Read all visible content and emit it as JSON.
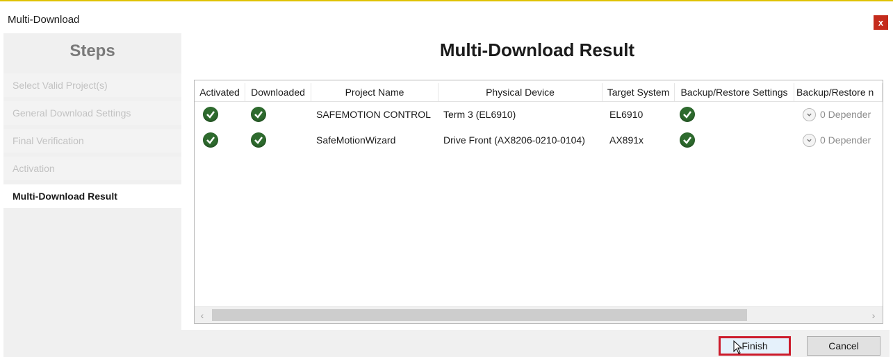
{
  "window": {
    "title": "Multi-Download",
    "close_label": "x"
  },
  "sidebar": {
    "title": "Steps",
    "items": [
      {
        "label": "Select Valid Project(s)",
        "active": false
      },
      {
        "label": "General Download Settings",
        "active": false
      },
      {
        "label": "Final Verification",
        "active": false
      },
      {
        "label": "Activation",
        "active": false
      },
      {
        "label": "Multi-Download Result",
        "active": true
      }
    ]
  },
  "main": {
    "title": "Multi-Download Result",
    "columns": [
      "Activated",
      "Downloaded",
      "Project Name",
      "Physical Device",
      "Target System",
      "Backup/Restore Settings",
      "Backup/Restore n"
    ],
    "rows": [
      {
        "activated": "check-icon",
        "downloaded": "check-icon",
        "project_name": "SAFEMOTION CONTROL",
        "physical_device": "Term 3 (EL6910)",
        "target_system": "EL6910",
        "backup_restore_settings": "check-icon",
        "dependencies": "0 Depender"
      },
      {
        "activated": "check-icon",
        "downloaded": "check-icon",
        "project_name": "SafeMotionWizard",
        "physical_device": "Drive Front (AX8206-0210-0104)",
        "target_system": "AX891x",
        "backup_restore_settings": "check-icon",
        "dependencies": "0 Depender"
      }
    ],
    "scroll_left": "‹",
    "scroll_right": "›"
  },
  "footer": {
    "finish_label": "Finish",
    "cancel_label": "Cancel"
  },
  "colors": {
    "success": "#2e6b2e",
    "highlight_border": "#cc1a2a",
    "close": "#c42b1c"
  }
}
